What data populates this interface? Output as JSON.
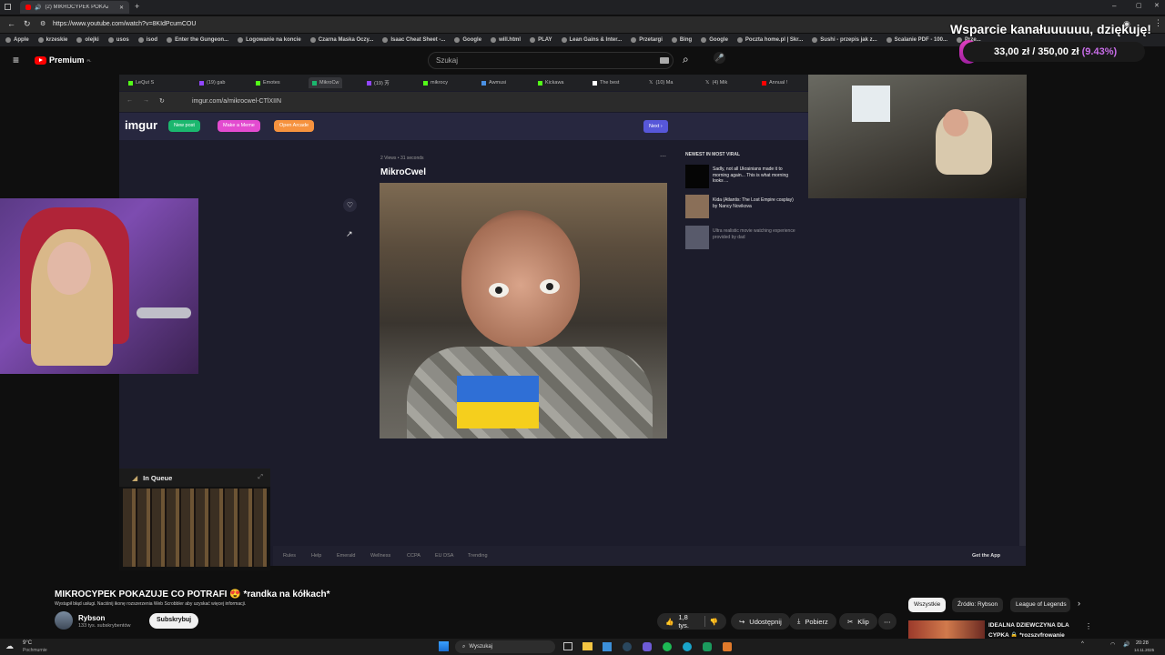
{
  "browser": {
    "tab_title": "(2) MIKROCYPEK POKAZUJE",
    "url": "https://www.youtube.com/watch?v=8KIdPcumCOU",
    "bookmarks": [
      "Apple",
      "krzeskie",
      "olejki",
      "usos",
      "isod",
      "Enter the Gungeon...",
      "Logowanie na koncie",
      "Czarna Maska Oczy...",
      "Isaac Cheat Sheet -...",
      "Google",
      "will.html",
      "PLAY",
      "Lean Gains & Inter...",
      "Przetargi",
      "Bing",
      "Google",
      "Poczta home.pl | Skr...",
      "Sushi - przepis jak z...",
      "Scalanie PDF - 100...",
      "Prze..."
    ]
  },
  "youtube": {
    "brand": "Premium",
    "brand_sup": "PL",
    "search_placeholder": "Szukaj"
  },
  "donation": {
    "title": "Wsparcie kanałuuuuuu, dziękuję!",
    "amount": "33,00 zł / 350,00 zł",
    "percent_text": "(9.43%)",
    "progress": 0.0943
  },
  "inner_browser": {
    "tabs": [
      "LeQut S",
      "(19) gab",
      "Emotes",
      "MikroCw",
      "(19) 芳",
      "mikrocy",
      "Awmusi",
      "Kickawa",
      "The best",
      "(10) Ma",
      "(4) Mik",
      "Annual !"
    ],
    "url": "imgur.com/a/mikrocwel-CTlXIIN"
  },
  "imgur": {
    "logo": "imgur",
    "btn_new_post": "New post",
    "btn_meme": "Make a Meme",
    "btn_arcade": "Open Arcade",
    "btn_next": "Next",
    "meta": "2 Views • 31 seconds",
    "post_title": "MikroCwel",
    "sidebar_heading": "NEWEST IN MOST VIRAL",
    "sidebar_posts": [
      "Sadly, not all Ukrainians made it to morning again... This is what morning looks ...",
      "Kida (Atlantis: The Lost Empire cosplay) by Nancy Novikova",
      "Ultra realistic movie watching experience provided by dad"
    ],
    "footer_links": [
      "Rules",
      "Help",
      "Emerald",
      "Wellness",
      "CCPA",
      "EU DSA",
      "Trending"
    ],
    "get_app": "Get the App"
  },
  "queue": {
    "title": "In Queue"
  },
  "video_info": {
    "title": "MIKROCYPEK POKAZUJE CO POTRAFI 😍 *randka na kółkach*",
    "error_notice": "Wystąpił błąd usługi. Naciśnij ikonę rozszerzenia Web Scrobbler aby uzyskać więcej informacji.",
    "channel": "Rybson",
    "subscribers": "133 tys. subskrybentów",
    "subscribe": "Subskrybuj",
    "likes": "1,8 tys.",
    "share": "Udostępnij",
    "download": "Pobierz",
    "clip": "Klip",
    "chips": [
      "Wszystkie",
      "Źródło: Rybson",
      "League of Legends"
    ],
    "rec_title_1": "IDEALNA DZIEWCZYNA DLA",
    "rec_title_2": "CYPKA 🔒 *rozszyfrowanie"
  },
  "taskbar": {
    "weather_temp": "9°C",
    "weather_desc": "Pochmurnie",
    "search": "Wyszukaj",
    "time": "20:28",
    "date": "14.11.2025"
  },
  "colors": {
    "imgur_green": "#1bb76e",
    "imgur_pink": "#e34bd0",
    "imgur_orange": "#f6923e",
    "imgur_next": "#5757d9",
    "donation_percent": "#c86de8",
    "yt_red": "#ff0000"
  }
}
